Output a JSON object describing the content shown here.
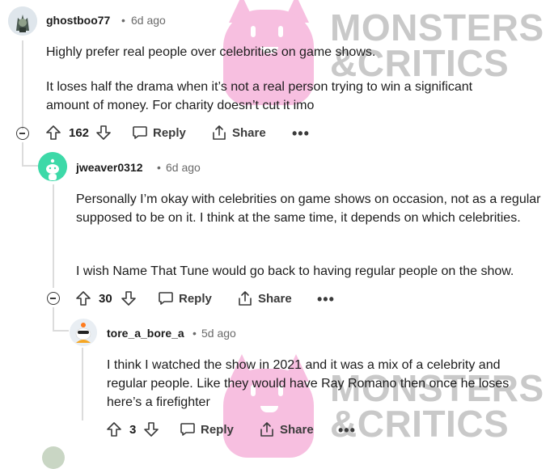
{
  "watermark": {
    "line1": "MONSTERS",
    "line2": "&CRITICS"
  },
  "comments": [
    {
      "username": "ghostboo77",
      "time": "6d ago",
      "paragraphs": [
        "Highly prefer real people over celebrities on game shows.",
        "It loses half the drama when it’s not a real person trying to win a significant amount of money. For charity doesn’t cut it imo"
      ],
      "votes": "162",
      "reply_label": "Reply",
      "share_label": "Share",
      "more_label": "•••"
    },
    {
      "username": "jweaver0312",
      "time": "6d ago",
      "paragraphs": [
        "Personally I’m okay with celebrities on game shows on occasion, not as a regular supposed to be on it. I think at the same time, it depends on which celebrities.",
        "I wish Name That Tune would go back to having regular people on the show."
      ],
      "votes": "30",
      "reply_label": "Reply",
      "share_label": "Share",
      "more_label": "•••"
    },
    {
      "username": "tore_a_bore_a",
      "time": "5d ago",
      "paragraphs": [
        "I think I watched the show in 2021 and it was a mix of a celebrity and regular people. Like they would have Ray Romano then once he loses here’s a firefighter"
      ],
      "votes": "3",
      "reply_label": "Reply",
      "share_label": "Share",
      "more_label": "•••"
    }
  ],
  "separator": "•",
  "colors": {
    "text": "#1c1c1c",
    "muted": "#6a6a6a",
    "watermark_pink": "#f7bfe0",
    "watermark_gray": "#c4c4c4"
  }
}
